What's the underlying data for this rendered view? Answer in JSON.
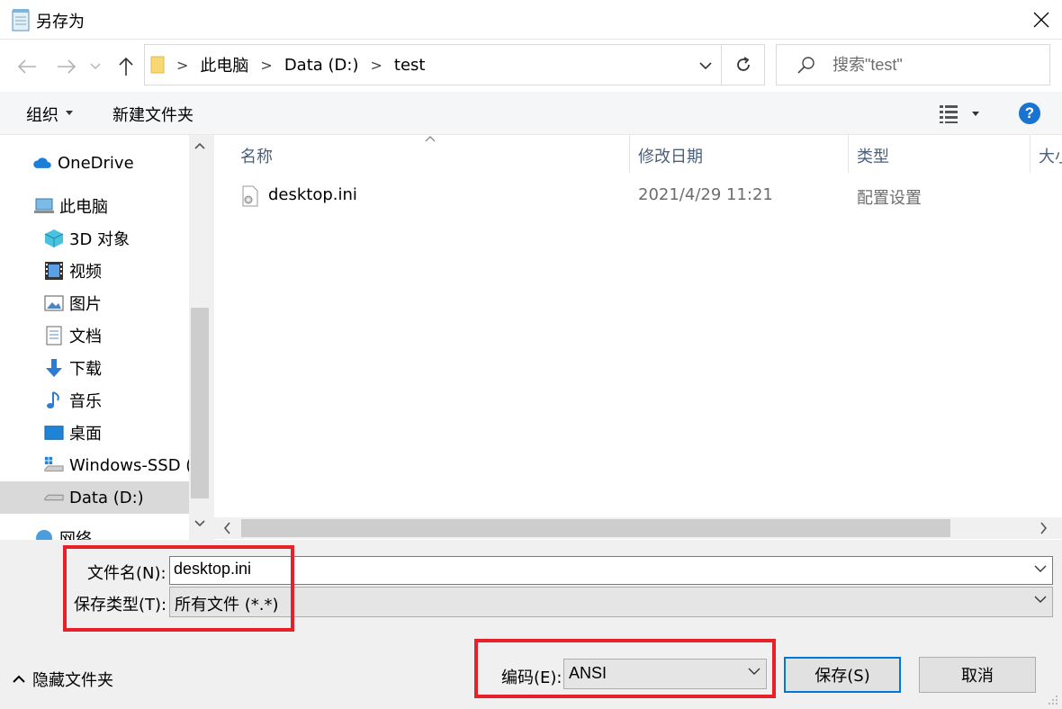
{
  "window": {
    "title": "另存为"
  },
  "address": {
    "crumbs": [
      "此电脑",
      "Data (D:)",
      "test"
    ]
  },
  "search": {
    "placeholder": "搜索\"test\""
  },
  "toolbar": {
    "organize": "组织",
    "new_folder": "新建文件夹"
  },
  "nav": {
    "items": [
      {
        "label": "OneDrive",
        "icon": "onedrive-icon"
      },
      {
        "label": "此电脑",
        "icon": "computer-icon"
      },
      {
        "label": "3D 对象",
        "icon": "3d-objects-icon"
      },
      {
        "label": "视频",
        "icon": "video-icon"
      },
      {
        "label": "图片",
        "icon": "pictures-icon"
      },
      {
        "label": "文档",
        "icon": "documents-icon"
      },
      {
        "label": "下载",
        "icon": "download-icon"
      },
      {
        "label": "音乐",
        "icon": "music-icon"
      },
      {
        "label": "桌面",
        "icon": "desktop-icon"
      },
      {
        "label": "Windows-SSD (",
        "icon": "drive-icon"
      },
      {
        "label": "Data (D:)",
        "icon": "drive-icon",
        "selected": true
      },
      {
        "label": "网络",
        "icon": "network-icon"
      }
    ]
  },
  "columns": {
    "name": "名称",
    "modified": "修改日期",
    "type": "类型",
    "size": "大小"
  },
  "files": [
    {
      "name": "desktop.ini",
      "modified": "2021/4/29 11:21",
      "type": "配置设置"
    }
  ],
  "form": {
    "filename_label": "文件名(N):",
    "filename_value": "desktop.ini",
    "filetype_label": "保存类型(T):",
    "filetype_value": "所有文件  (*.*)",
    "encoding_label": "编码(E):",
    "encoding_value": "ANSI"
  },
  "footer": {
    "hide_folders": "隐藏文件夹",
    "save": "保存(S)",
    "cancel": "取消"
  },
  "colors": {
    "highlight_box": "#e8202a",
    "accent": "#0078d7",
    "help": "#1a73d0"
  }
}
